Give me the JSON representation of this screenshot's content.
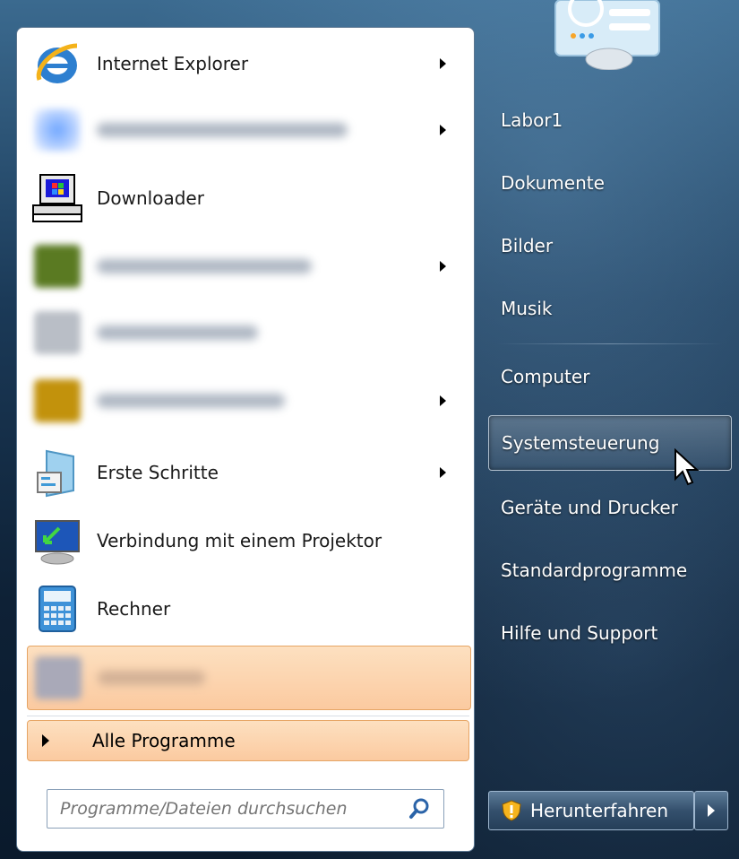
{
  "programs": [
    {
      "label": "Internet Explorer",
      "has_arrow": true,
      "icon": "internet-explorer-icon"
    },
    {
      "label": "",
      "blurred": true,
      "has_arrow": true,
      "icon": "blurred-app-icon"
    },
    {
      "label": "Downloader",
      "has_arrow": false,
      "icon": "downloader-icon"
    },
    {
      "label": "",
      "blurred": true,
      "has_arrow": true,
      "icon": "blurred-app-icon"
    },
    {
      "label": "",
      "blurred": true,
      "has_arrow": false,
      "icon": "blurred-app-icon"
    },
    {
      "label": "",
      "blurred": true,
      "has_arrow": true,
      "icon": "blurred-app-icon"
    },
    {
      "label": "Erste Schritte",
      "has_arrow": true,
      "icon": "getting-started-icon"
    },
    {
      "label": "Verbindung mit einem Projektor",
      "has_arrow": false,
      "icon": "projector-icon"
    },
    {
      "label": "Rechner",
      "has_arrow": false,
      "icon": "calculator-icon"
    },
    {
      "label": "",
      "blurred": true,
      "has_arrow": false,
      "highlighted": true,
      "icon": "blurred-app-icon"
    }
  ],
  "all_programs": {
    "label": "Alle Programme"
  },
  "search": {
    "placeholder": "Programme/Dateien durchsuchen"
  },
  "right_links": [
    {
      "label": "Labor1"
    },
    {
      "label": "Dokumente"
    },
    {
      "label": "Bilder"
    },
    {
      "label": "Musik"
    },
    {
      "label": "Computer"
    },
    {
      "label": "Systemsteuerung",
      "hover": true
    },
    {
      "label": "Geräte und Drucker"
    },
    {
      "label": "Standardprogramme"
    },
    {
      "label": "Hilfe und Support"
    }
  ],
  "shutdown": {
    "label": "Herunterfahren"
  },
  "colors": {
    "highlight": "#fbcaa0",
    "panel_bg": "#ffffff",
    "right_bg": "#1b3a58"
  }
}
